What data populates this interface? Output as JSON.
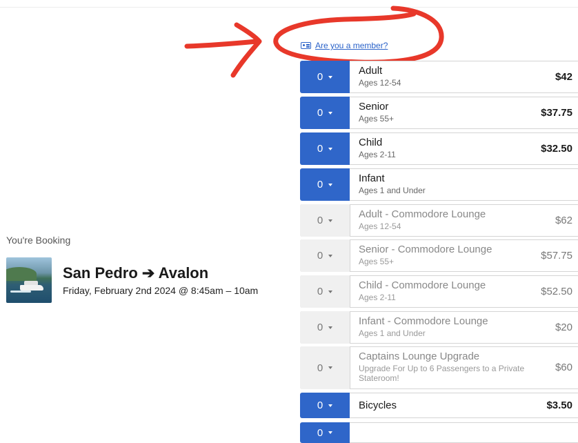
{
  "member_link": {
    "label": "Are you a member?"
  },
  "annotation": {
    "color": "#e8382a"
  },
  "booking": {
    "heading": "You're Booking",
    "route": "San Pedro ➔ Avalon",
    "datetime": "Friday, February 2nd 2024 @ 8:45am – 10am"
  },
  "fares": [
    {
      "qty": "0",
      "name": "Adult",
      "sub": "Ages 12-54",
      "price": "$42",
      "active": true
    },
    {
      "qty": "0",
      "name": "Senior",
      "sub": "Ages 55+",
      "price": "$37.75",
      "active": true
    },
    {
      "qty": "0",
      "name": "Child",
      "sub": "Ages 2-11",
      "price": "$32.50",
      "active": true
    },
    {
      "qty": "0",
      "name": "Infant",
      "sub": "Ages 1 and Under",
      "price": "",
      "active": true
    },
    {
      "qty": "0",
      "name": "Adult - Commodore Lounge",
      "sub": "Ages 12-54",
      "price": "$62",
      "active": false
    },
    {
      "qty": "0",
      "name": "Senior - Commodore Lounge",
      "sub": "Ages 55+",
      "price": "$57.75",
      "active": false
    },
    {
      "qty": "0",
      "name": "Child - Commodore Lounge",
      "sub": "Ages 2-11",
      "price": "$52.50",
      "active": false
    },
    {
      "qty": "0",
      "name": "Infant - Commodore Lounge",
      "sub": "Ages 1 and Under",
      "price": "$20",
      "active": false
    },
    {
      "qty": "0",
      "name": "Captains Lounge Upgrade",
      "sub": "Upgrade For Up to 6 Passengers to a Private Stateroom!",
      "price": "$60",
      "active": false
    },
    {
      "qty": "0",
      "name": "Bicycles",
      "sub": "",
      "price": "$3.50",
      "active": true
    },
    {
      "qty": "0",
      "name": "",
      "sub": "",
      "price": "",
      "active": true
    }
  ],
  "colors": {
    "accent": "#2f66c9",
    "link": "#2a62c9"
  }
}
